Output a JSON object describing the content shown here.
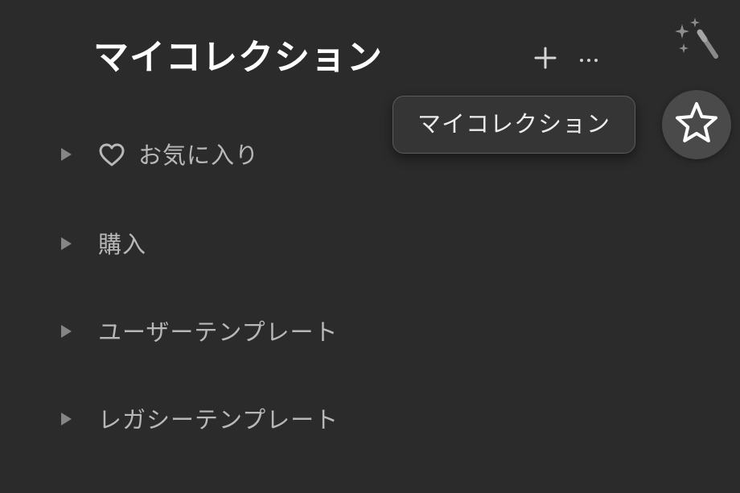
{
  "header": {
    "title": "マイコレクション",
    "add_icon": "plus-icon",
    "more_icon": "ellipsis-icon",
    "magic_icon": "magic-wand-icon"
  },
  "tooltip": {
    "text": "マイコレクション"
  },
  "star_button": {
    "icon": "star-icon"
  },
  "collections": [
    {
      "label": "お気に入り",
      "icon": "heart-icon",
      "expand_icon": "triangle-right-icon"
    },
    {
      "label": "購入",
      "expand_icon": "triangle-right-icon"
    },
    {
      "label": "ユーザーテンプレート",
      "expand_icon": "triangle-right-icon"
    },
    {
      "label": "レガシーテンプレート",
      "expand_icon": "triangle-right-icon"
    }
  ],
  "colors": {
    "background": "#2b2b2b",
    "title": "#ffffff",
    "item_text": "#b8b8b8",
    "tooltip_bg": "#353535",
    "tooltip_border": "#5c5c5c",
    "star_bg": "#4a4a4a"
  }
}
